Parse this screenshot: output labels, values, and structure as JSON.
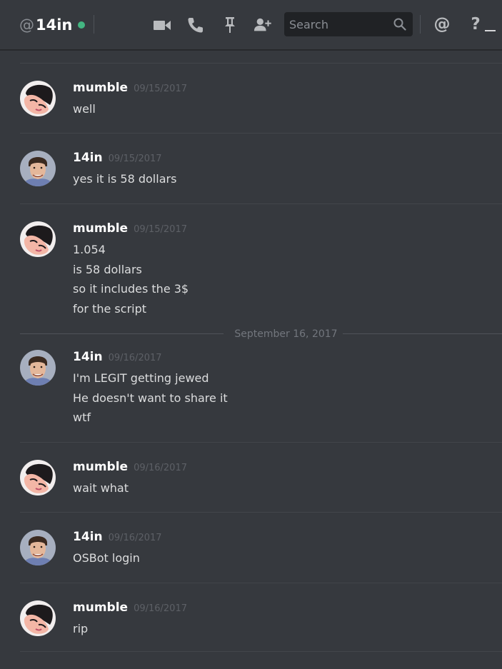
{
  "header": {
    "at_symbol": "@",
    "channel_name": "14in",
    "status_color": "#43b581",
    "search_placeholder": "Search",
    "icons": [
      "video-camera-icon",
      "phone-icon",
      "pin-icon",
      "add-friend-icon",
      "search-icon",
      "at-mention-icon",
      "help-icon",
      "minimize-icon"
    ],
    "mention_label": "@",
    "help_label": "?"
  },
  "date_divider": "September 16, 2017",
  "messages": [
    {
      "username": "mumble",
      "timestamp": "09/15/2017",
      "lines": [
        "well"
      ]
    },
    {
      "username": "14in",
      "timestamp": "09/15/2017",
      "lines": [
        "yes it is 58 dollars"
      ]
    },
    {
      "username": "mumble",
      "timestamp": "09/15/2017",
      "lines": [
        "1.054",
        "is 58 dollars",
        "so it includes the 3$",
        "for the script"
      ]
    },
    {
      "username": "14in",
      "timestamp": "09/16/2017",
      "lines": [
        "I'm LEGIT getting jewed",
        "He doesn't want to share it",
        "wtf"
      ]
    },
    {
      "username": "mumble",
      "timestamp": "09/16/2017",
      "lines": [
        "wait what"
      ]
    },
    {
      "username": "14in",
      "timestamp": "09/16/2017",
      "lines": [
        "OSBot login"
      ]
    },
    {
      "username": "mumble",
      "timestamp": "09/16/2017",
      "lines": [
        "rip"
      ]
    }
  ],
  "colors": {
    "background": "#36393e",
    "username": "#ffffff",
    "message_text": "#dcddde",
    "timestamp": "#5d6066",
    "divider": "#42454a"
  }
}
